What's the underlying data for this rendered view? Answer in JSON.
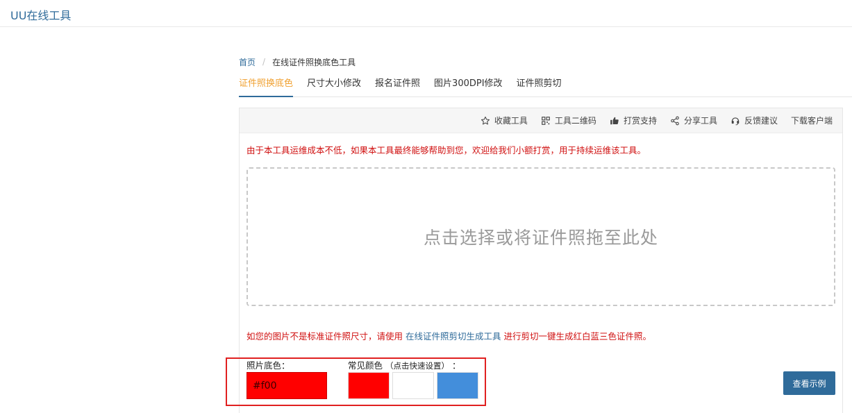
{
  "header": {
    "brand": "UU在线工具"
  },
  "breadcrumb": {
    "home": "首页",
    "separator": "/",
    "current": "在线证件照换底色工具"
  },
  "tabs": [
    {
      "label": "证件照换底色",
      "active": true
    },
    {
      "label": "尺寸大小修改"
    },
    {
      "label": "报名证件照"
    },
    {
      "label": "图片300DPI修改"
    },
    {
      "label": "证件照剪切"
    }
  ],
  "toolbar": [
    {
      "label": "收藏工具",
      "icon": "star-icon"
    },
    {
      "label": "工具二维码",
      "icon": "qrcode-icon"
    },
    {
      "label": "打赏支持",
      "icon": "thumbs-up-icon"
    },
    {
      "label": "分享工具",
      "icon": "share-icon"
    },
    {
      "label": "反馈建议",
      "icon": "headset-icon"
    },
    {
      "label": "下载客户端",
      "icon": ""
    }
  ],
  "notice": "由于本工具运维成本不低，如果本工具最终能够帮助到您，欢迎给我们小额打赏，用于持续运维该工具。",
  "dropzone": {
    "text": "点击选择或将证件照拖至此处"
  },
  "tip": {
    "before": "如您的图片不是标准证件照尺寸，请使用 ",
    "link": "在线证件照剪切生成工具",
    "after": " 进行剪切一键生成红白蓝三色证件照。"
  },
  "colors": {
    "bg_label": "照片底色：",
    "common_label": "常见颜色",
    "common_hint": "（点击快速设置）",
    "common_colon": "：",
    "input_value": "#f00",
    "swatches": [
      "#ff0000",
      "#ffffff",
      "#438edb"
    ]
  },
  "actions": {
    "view_example": "查看示例"
  },
  "theme": {
    "accent": "#2f6b9a",
    "active_tab": "#f0a030",
    "warning": "#d01010",
    "highlight_box": "#e02020"
  }
}
